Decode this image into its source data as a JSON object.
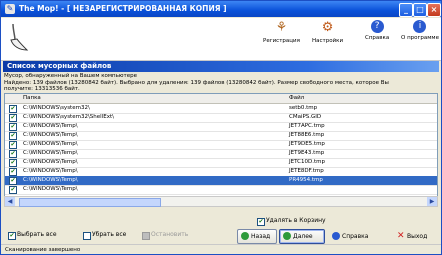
{
  "window": {
    "title": "The Mop! - [ НЕЗАРЕГИСТРИРОВАННАЯ КОПИЯ ]"
  },
  "toolbar": {
    "items": [
      {
        "label": "Регистрация",
        "icon": "register-icon"
      },
      {
        "label": "Настройки",
        "icon": "settings-icon"
      },
      {
        "label": "Справка",
        "icon": "help-icon"
      },
      {
        "label": "О программе",
        "icon": "about-icon"
      }
    ]
  },
  "section": {
    "title": "Список мусорных файлов"
  },
  "info": {
    "line1": "Мусор, обнаруженный на Вашем компьютере",
    "line2": "Найдено: 139 файлов (13280842 байт).    Выбрано для удаления: 139 файлов (13280842 байт).    Размер свободного места, которое Вы",
    "line3": "получите: 13313536 байт."
  },
  "table": {
    "headers": {
      "folder": "Папка",
      "file": "Файл"
    },
    "rows": [
      {
        "checked": true,
        "folder": "C:\\WINDOWS\\system32\\",
        "file": "setb0.tmp",
        "selected": false
      },
      {
        "checked": true,
        "folder": "C:\\WINDOWS\\system32\\ShellExt\\",
        "file": "CMaiPS.GID",
        "selected": false
      },
      {
        "checked": true,
        "folder": "C:\\WINDOWS\\Temp\\",
        "file": "JET7APC.tmp",
        "selected": false
      },
      {
        "checked": true,
        "folder": "C:\\WINDOWS\\Temp\\",
        "file": "JET88E6.tmp",
        "selected": false
      },
      {
        "checked": true,
        "folder": "C:\\WINDOWS\\Temp\\",
        "file": "JET9DE5.tmp",
        "selected": false
      },
      {
        "checked": true,
        "folder": "C:\\WINDOWS\\Temp\\",
        "file": "JET9E43.tmp",
        "selected": false
      },
      {
        "checked": true,
        "folder": "C:\\WINDOWS\\Temp\\",
        "file": "JETC10D.tmp",
        "selected": false
      },
      {
        "checked": true,
        "folder": "C:\\WINDOWS\\Temp\\",
        "file": "JETE8DF.tmp",
        "selected": false
      },
      {
        "checked": true,
        "folder": "C:\\WINDOWS\\Temp\\",
        "file": "PR4954.tmp",
        "selected": true
      },
      {
        "checked": true,
        "folder": "C:\\WINDOWS\\Temp\\",
        "file": "",
        "selected": false
      }
    ]
  },
  "recycle": {
    "label": "Удалять в Корзину",
    "checked": true
  },
  "buttons": {
    "select_all": "Выбрать все",
    "deselect_all": "Убрать все",
    "stop": "Остановить",
    "back": "Назад",
    "next": "Далее",
    "help": "Справка",
    "exit": "Выход"
  },
  "status": {
    "text": "Сканирование завершено"
  }
}
